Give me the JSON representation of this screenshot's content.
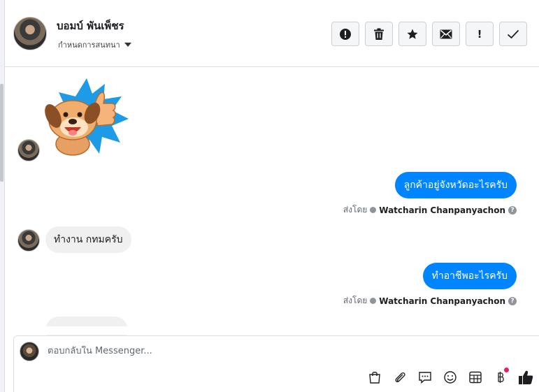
{
  "header": {
    "contact_name": "บอมบ์ พันเพ็ชร",
    "conversation_settings_label": "กำหนดการสนทนา",
    "actions": [
      {
        "icon": "exclamation-circle-icon"
      },
      {
        "icon": "trash-icon"
      },
      {
        "icon": "star-icon"
      },
      {
        "icon": "envelope-icon"
      },
      {
        "icon": "exclamation-icon",
        "glyph": "!"
      },
      {
        "icon": "checkmark-icon"
      }
    ]
  },
  "messages": [
    {
      "direction": "in",
      "type": "sticker",
      "icon": "thumbs-up-dog-sticker"
    },
    {
      "direction": "out",
      "text": "ลูกค้าอยู่จังหวัดอะไรครับ",
      "sent_by_label": "ส่งโดย",
      "sender": "Watcharin Chanpanyachon"
    },
    {
      "direction": "in",
      "text": "ทำงาน กทมครับ"
    },
    {
      "direction": "out",
      "text": "ทำอาชีพอะไรครับ",
      "sent_by_label": "ส่งโดย",
      "sender": "Watcharin Chanpanyachon"
    }
  ],
  "composer": {
    "placeholder": "ตอบกลับใน Messenger...",
    "tools": [
      "shopping-bag-icon",
      "paperclip-icon",
      "saved-reply-icon",
      "emoji-icon",
      "table-icon",
      "baht-payment-icon",
      "like-icon"
    ]
  },
  "colors": {
    "accent": "#0084ff",
    "incoming_bubble": "#f0f0f0",
    "notification_dot": "#e0245e"
  }
}
